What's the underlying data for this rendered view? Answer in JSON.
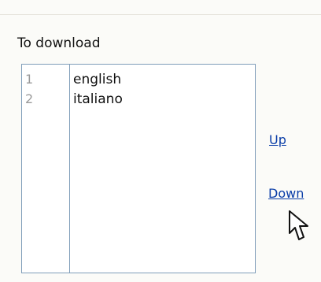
{
  "section": {
    "label": "To download"
  },
  "list": {
    "items": [
      {
        "index": "1",
        "label": "english"
      },
      {
        "index": "2",
        "label": "italiano"
      }
    ]
  },
  "actions": {
    "up_label": "Up",
    "down_label": "Down"
  },
  "icons": {
    "cursor": "mouse-pointer-icon"
  },
  "colors": {
    "background": "#fbfbf8",
    "border": "#7f9db9",
    "link": "#0b3ea8",
    "index_text": "#9a9a9a"
  }
}
